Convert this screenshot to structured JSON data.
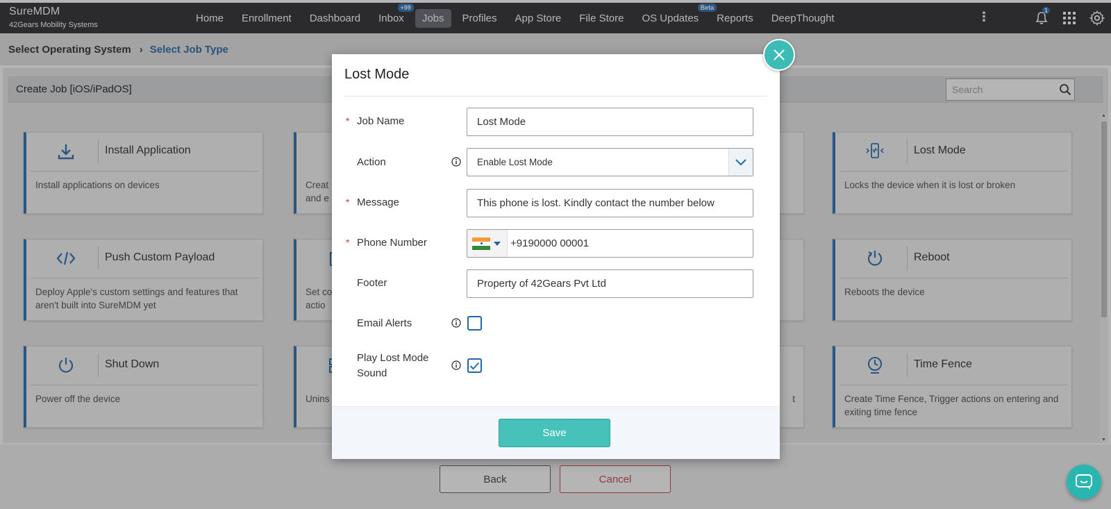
{
  "brand": {
    "name": "SureMDM",
    "company": "42Gears Mobility Systems"
  },
  "nav": {
    "items": [
      {
        "label": "Home"
      },
      {
        "label": "Enrollment"
      },
      {
        "label": "Dashboard"
      },
      {
        "label": "Inbox",
        "badge": "+99"
      },
      {
        "label": "Jobs",
        "active": true
      },
      {
        "label": "Profiles"
      },
      {
        "label": "App Store"
      },
      {
        "label": "File Store"
      },
      {
        "label": "OS Updates",
        "badge": "Beta"
      },
      {
        "label": "Reports"
      },
      {
        "label": "DeepThought"
      }
    ],
    "more_glyph": "⋮",
    "notification_count": "1"
  },
  "breadcrumb": {
    "step1": "Select Operating System",
    "separator": "›",
    "step2": "Select Job Type"
  },
  "create_job": {
    "title": "Create Job [iOS/iPadOS]",
    "search_placeholder": "Search"
  },
  "cards": [
    {
      "title": "Install Application",
      "desc": "Install applications on devices",
      "icon": "download-icon"
    },
    {
      "title": "Lost Mode",
      "desc": "Locks the device when it is lost or broken",
      "icon": "lost-phone-icon"
    },
    {
      "title": "Push Custom Payload",
      "desc": "Deploy Apple's custom settings and features that aren't built into SureMDM yet",
      "icon": "code-icon"
    },
    {
      "title": "Reboot",
      "desc": "Reboots the device",
      "icon": "power-icon"
    },
    {
      "title": "Shut Down",
      "desc": "Power off the device",
      "icon": "power-icon"
    },
    {
      "title": "Time Fence",
      "desc": "Create Time Fence, Trigger actions on entering and exiting time fence",
      "icon": "clock-pin-icon"
    }
  ],
  "partial_cards": [
    {
      "desc1": "Creat",
      "desc2": "and e"
    },
    {
      "desc1": "Set co",
      "desc2": "actio"
    },
    {
      "desc1": "Unins",
      "desc2": ""
    }
  ],
  "partial_right_desc": "t",
  "bottom": {
    "back_label": "Back",
    "cancel_label": "Cancel"
  },
  "modal": {
    "title": "Lost Mode",
    "fields": {
      "job_name": {
        "label": "Job Name",
        "value": "Lost Mode"
      },
      "action": {
        "label": "Action",
        "value": "Enable Lost Mode"
      },
      "message": {
        "label": "Message",
        "value": "This phone is lost. Kindly contact the number below"
      },
      "phone": {
        "label": "Phone Number",
        "value": "+9190000 00001",
        "country": "India"
      },
      "footer": {
        "label": "Footer",
        "value": "Property of 42Gears Pvt Ltd"
      },
      "email_alerts": {
        "label": "Email Alerts",
        "checked": false
      },
      "play_sound": {
        "label_line1": "Play Lost Mode",
        "label_line2": "Sound",
        "checked": true
      }
    },
    "required_mark": "*",
    "save_label": "Save"
  },
  "colors": {
    "accent": "#1f67b1",
    "teal": "#46c2bb",
    "danger": "#c43c3c",
    "topbar": "#212124"
  }
}
